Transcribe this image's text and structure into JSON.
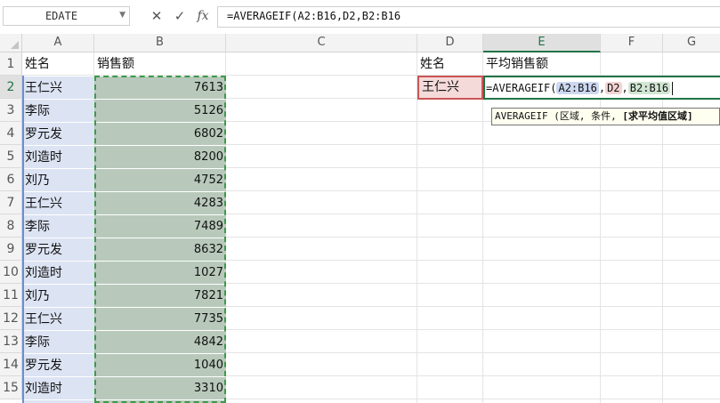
{
  "formula_bar": {
    "name_box": "EDATE",
    "cancel_icon": "✕",
    "confirm_icon": "✓",
    "fx_label": "fx",
    "formula": "=AVERAGEIF(A2:B16,D2,B2:B16"
  },
  "columns": [
    "A",
    "B",
    "C",
    "D",
    "E",
    "F",
    "G"
  ],
  "rows": [
    "1",
    "2",
    "3",
    "4",
    "5",
    "6",
    "7",
    "8",
    "9",
    "10",
    "11",
    "12",
    "13",
    "14",
    "15"
  ],
  "sheet": {
    "a1": "姓名",
    "b1": "销售额",
    "d1": "姓名",
    "e1": "平均销售额",
    "d2": "王仁兴",
    "names": [
      "王仁兴",
      "李际",
      "罗元发",
      "刘造时",
      "刘乃",
      "王仁兴",
      "李际",
      "罗元发",
      "刘造时",
      "刘乃",
      "王仁兴",
      "李际",
      "罗元发",
      "刘造时"
    ],
    "sales": [
      "7613",
      "5126",
      "6802",
      "8200",
      "4752",
      "4283",
      "7489",
      "8632",
      "1027",
      "7821",
      "7735",
      "4842",
      "1040",
      "3310"
    ]
  },
  "edit_cell": {
    "prefix": "=AVERAGEIF(",
    "ref1": "A2:B16",
    "sep1": ",",
    "ref2": "D2",
    "sep2": ",",
    "ref3": "B2:B16"
  },
  "tooltip": {
    "text": "AVERAGEIF (区域, 条件, ",
    "bold": "[求平均值区域]"
  },
  "colors": {
    "accent": "#217346",
    "range_highlight": "#b8c9bb",
    "name_highlight": "#dce3f3",
    "criteria_highlight": "#f5dada"
  }
}
